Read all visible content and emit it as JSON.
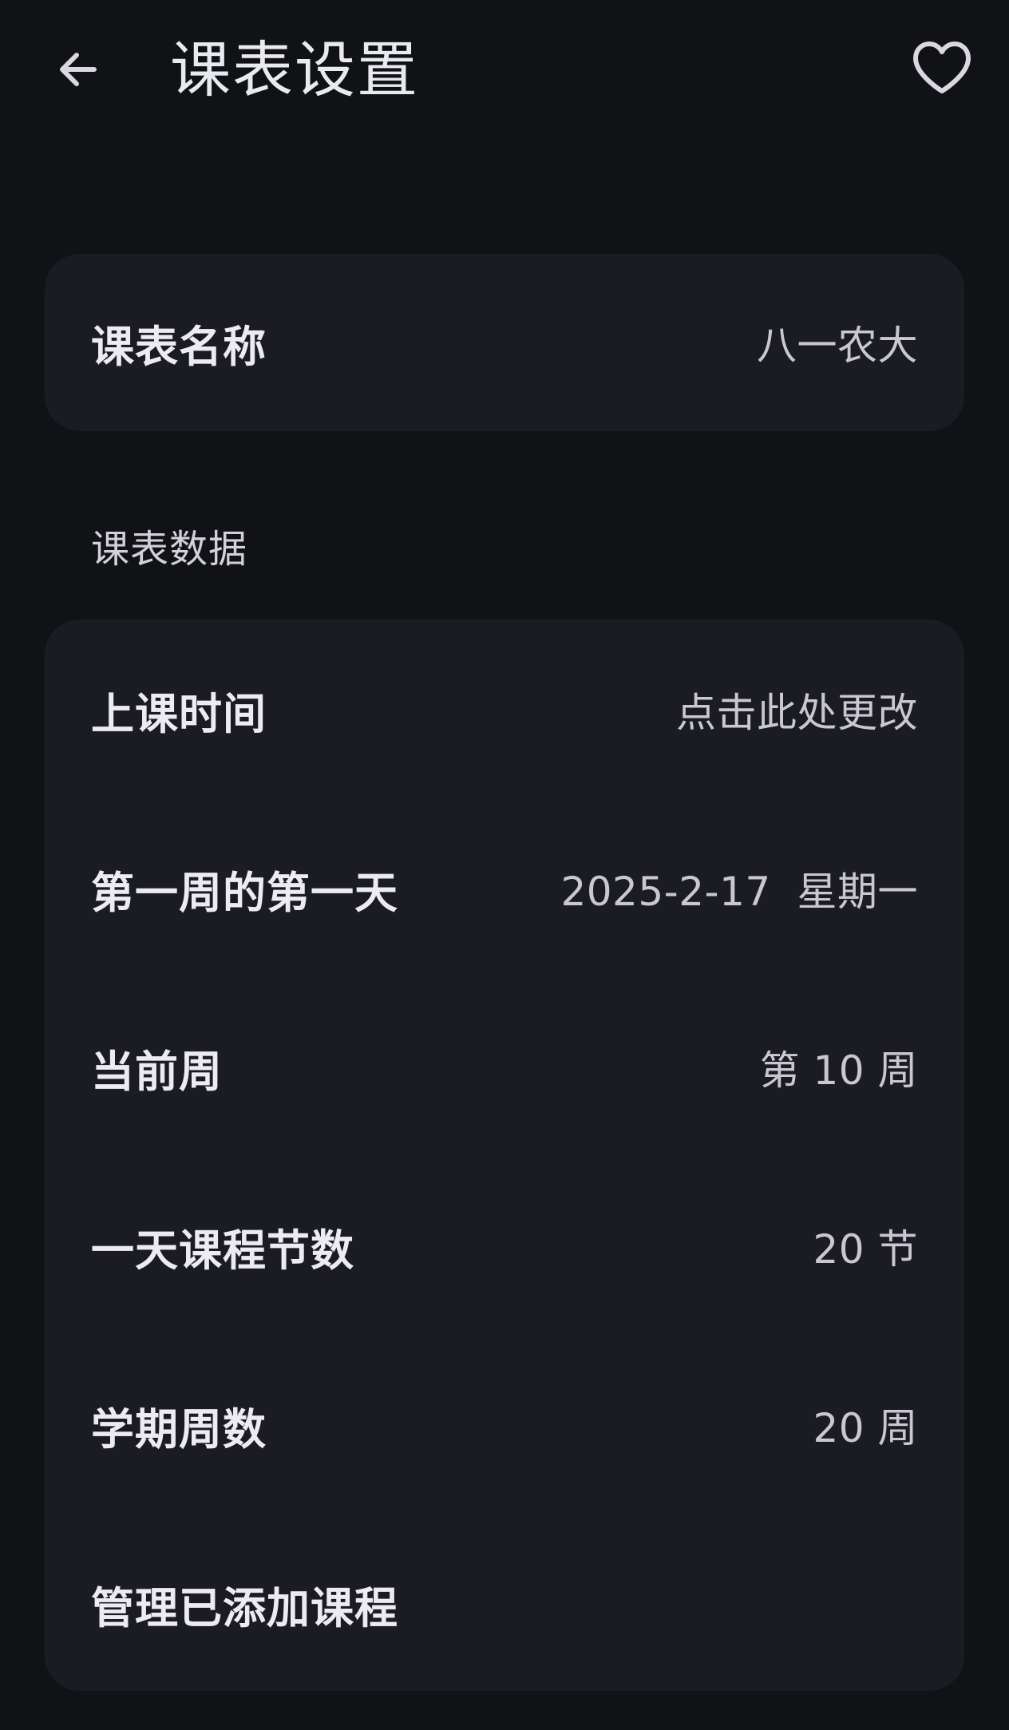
{
  "header": {
    "title": "课表设置",
    "back_icon": "arrow-left-icon",
    "favorite_icon": "heart-outline-icon"
  },
  "name_card": {
    "label": "课表名称",
    "value": "八一农大"
  },
  "section": {
    "title": "课表数据"
  },
  "settings": [
    {
      "label": "上课时间",
      "value": "点击此处更改"
    },
    {
      "label": "第一周的第一天",
      "value": "2025-2-17  星期一"
    },
    {
      "label": "当前周",
      "value": "第 10 周"
    },
    {
      "label": "一天课程节数",
      "value": "20 节"
    },
    {
      "label": "学期周数",
      "value": "20 周"
    },
    {
      "label": "管理已添加课程",
      "value": ""
    }
  ],
  "colors": {
    "background": "#111216",
    "card": "#1b1c23",
    "text_primary": "#ecebf3",
    "text_secondary": "#c9c8d2"
  }
}
